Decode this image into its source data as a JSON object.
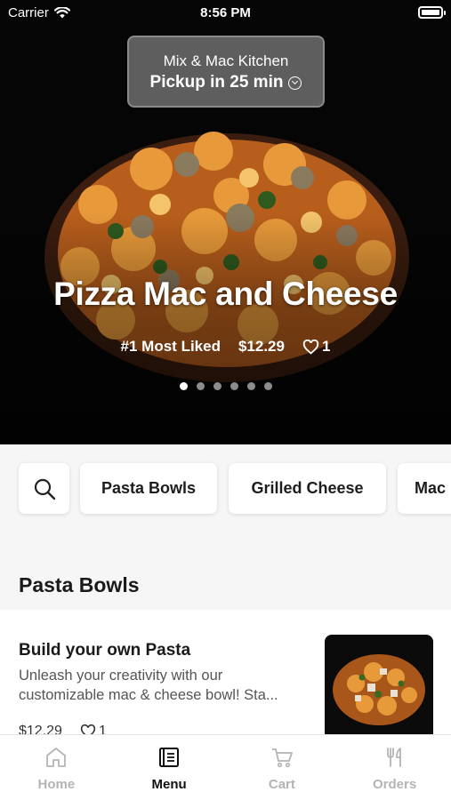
{
  "status_bar": {
    "carrier": "Carrier",
    "time": "8:56 PM"
  },
  "pickup": {
    "store": "Mix & Mac Kitchen",
    "time": "Pickup in 25 min"
  },
  "hero": {
    "title": "Pizza Mac and Cheese",
    "badge": "#1 Most Liked",
    "price": "$12.29",
    "likes": "1",
    "slides_total": 6,
    "active_slide": 1
  },
  "categories": {
    "items": [
      "Pasta Bowls",
      "Grilled Cheese",
      "Mac"
    ]
  },
  "section": {
    "title": "Pasta Bowls"
  },
  "menu_item": {
    "name": "Build your own Pasta",
    "description": "Unleash your creativity with our customizable mac & cheese bowl! Sta...",
    "price": "$12.29",
    "likes": "1"
  },
  "tabs": [
    {
      "label": "Home",
      "icon": "home-icon",
      "active": false
    },
    {
      "label": "Menu",
      "icon": "menu-book-icon",
      "active": true
    },
    {
      "label": "Cart",
      "icon": "cart-icon",
      "active": false
    },
    {
      "label": "Orders",
      "icon": "fork-knife-icon",
      "active": false
    }
  ],
  "colors": {
    "active_tab": "#111111",
    "inactive_tab": "#b4b4b4",
    "hero_bg": "#050505"
  }
}
